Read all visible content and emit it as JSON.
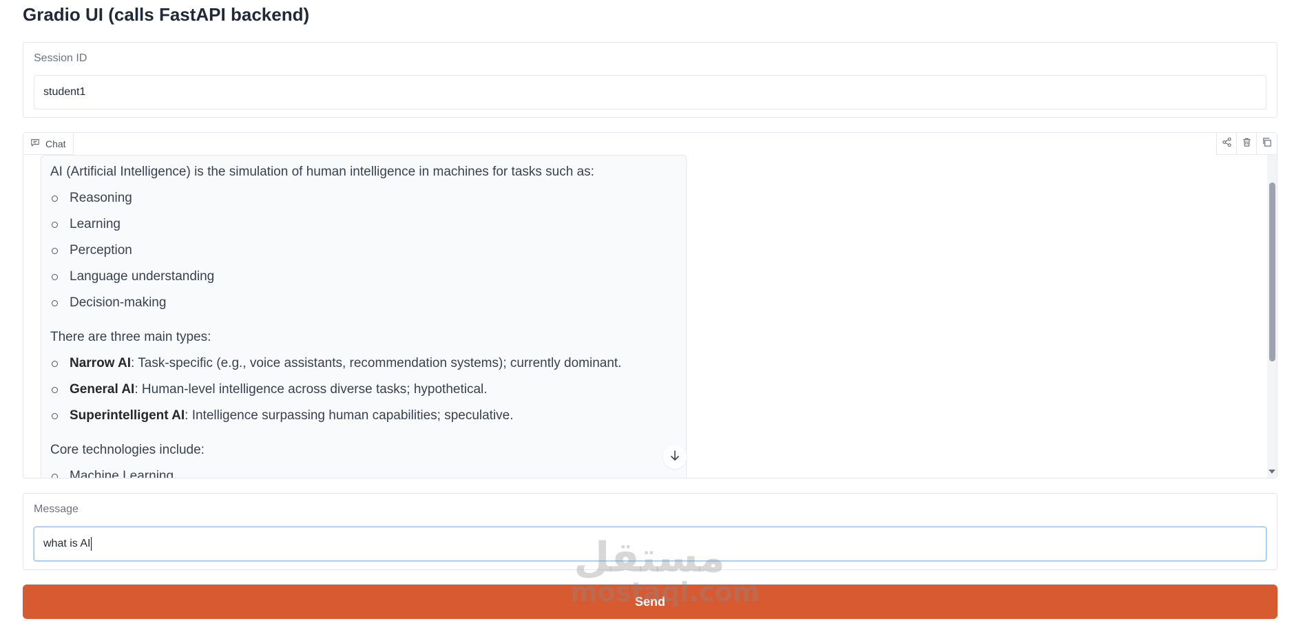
{
  "app": {
    "title": "Gradio UI (calls FastAPI backend)"
  },
  "session": {
    "label": "Session ID",
    "value": "student1"
  },
  "chat": {
    "tab_label": "Chat",
    "tab_icon": "chat-icon",
    "tools": [
      {
        "name": "share-icon"
      },
      {
        "name": "trash-icon"
      },
      {
        "name": "copy-icon"
      }
    ],
    "message": {
      "intro": "AI (Artificial Intelligence) is the simulation of human intelligence in machines for tasks such as:",
      "tasks": [
        "Reasoning",
        "Learning",
        "Perception",
        "Language understanding",
        "Decision-making"
      ],
      "types_heading": "There are three main types:",
      "types": [
        {
          "term": "Narrow AI",
          "desc": ": Task-specific (e.g., voice assistants, recommendation systems); currently dominant."
        },
        {
          "term": "General AI",
          "desc": ": Human-level intelligence across diverse tasks; hypothetical."
        },
        {
          "term": "Superintelligent AI",
          "desc": ": Intelligence surpassing human capabilities; speculative."
        }
      ],
      "core_heading": "Core technologies include:",
      "core": [
        "Machine Learning"
      ]
    }
  },
  "composer": {
    "label": "Message",
    "value": "what is AI"
  },
  "send": {
    "label": "Send",
    "color": "#d85a30"
  },
  "watermark": {
    "arabic": "مستقل",
    "latin": "mostaql.com"
  }
}
